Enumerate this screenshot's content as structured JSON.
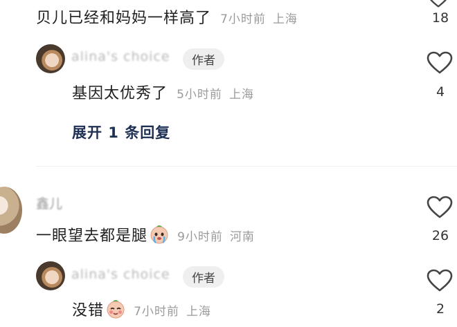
{
  "comments": [
    {
      "text": "贝儿已经和妈妈一样高了",
      "time": "7小时前",
      "location": "上海",
      "likes": "18",
      "reply": {
        "author": "alina's choice",
        "badge": "作者",
        "text": "基因太优秀了",
        "time": "5小时前",
        "location": "上海",
        "likes": "4"
      },
      "expand_label": "展开 1 条回复"
    },
    {
      "author": "鑫儿",
      "text": "一眼望去都是腿",
      "emoji": "crying-face-emoji",
      "time": "9小时前",
      "location": "河南",
      "likes": "26",
      "reply": {
        "author": "alina's choice",
        "badge": "作者",
        "text": "没错",
        "emoji": "blushing-face-emoji",
        "time": "7小时前",
        "location": "上海",
        "likes": "2"
      }
    }
  ],
  "icons": {
    "like": "heart-outline-icon"
  },
  "colors": {
    "link": "#1d2f52",
    "meta": "#9a9a9a",
    "badge_bg": "#efefef"
  }
}
